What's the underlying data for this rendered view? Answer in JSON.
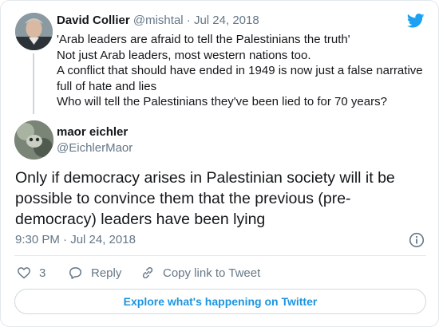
{
  "parent_tweet": {
    "name": "David Collier",
    "handle": "@mishtal",
    "separator": "·",
    "date": "Jul 24, 2018",
    "lines": [
      "'Arab leaders are afraid to tell the Palestinians the truth'",
      "Not just Arab leaders, most western nations too.",
      "A conflict that should have ended in 1949 is now just a false narrative",
      "full of hate and lies",
      "Who will tell the Palestinians they've been lied to for 70 years?"
    ]
  },
  "tweet": {
    "name": "maor eichler",
    "handle": "@EichlerMaor",
    "lines": [
      "Only if democracy arises in Palestinian society will it be",
      "possible to convince them that the previous (pre-",
      "democracy) leaders have been lying"
    ],
    "timestamp": "9:30 PM · Jul 24, 2018"
  },
  "actions": {
    "like_count": "3",
    "reply_label": "Reply",
    "copy_label": "Copy link to Tweet"
  },
  "explore_label": "Explore what's happening on Twitter",
  "colors": {
    "twitter_blue": "#1da1f2",
    "link_blue": "#1b95e0",
    "muted": "#657786",
    "text": "#14171a",
    "border": "#e1e8ed"
  },
  "icons": {
    "brand": "twitter-bird-icon",
    "info": "info-icon",
    "like": "heart-icon",
    "reply": "reply-bubble-icon",
    "copy": "link-icon"
  }
}
